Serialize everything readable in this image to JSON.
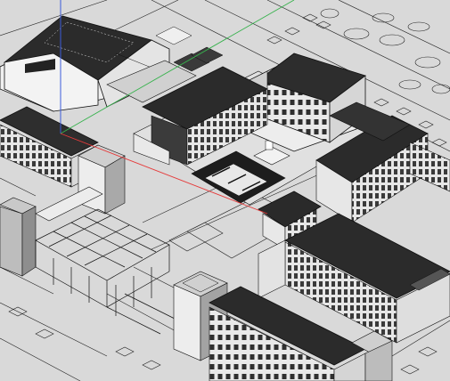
{
  "viewport": {
    "render_style": "hidden-line with shaded roofs",
    "background_color": "#d9d9d9",
    "line_color": "#1c1c1c",
    "roof_color": "#2e2e2e",
    "wall_color": "#e9e9e9",
    "axes": {
      "x_axis_color": "#e53b3b",
      "y_axis_color": "#37b24d",
      "z_axis_color": "#3b5bdb"
    }
  },
  "model": {
    "description_tags": [
      "campus-buildings",
      "courtyard",
      "stadium-roof",
      "towers",
      "pergola-frame"
    ]
  }
}
